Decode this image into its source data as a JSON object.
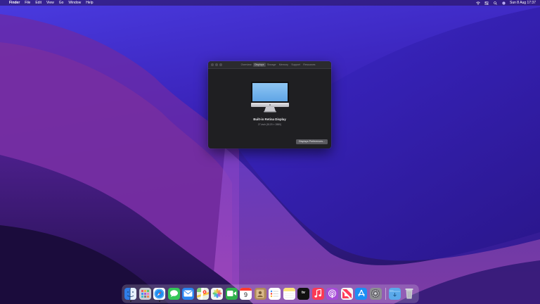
{
  "menubar": {
    "apple_glyph": "",
    "app_name": "Finder",
    "menus": [
      "File",
      "Edit",
      "View",
      "Go",
      "Window",
      "Help"
    ],
    "status_icons": [
      "wifi-icon",
      "control-center-icon",
      "search-icon",
      "siri-icon"
    ],
    "clock": "Sun 8 Aug 17:37"
  },
  "about_window": {
    "tabs": [
      "Overview",
      "Displays",
      "Storage",
      "Memory",
      "Support",
      "Resources"
    ],
    "active_tab": "Displays",
    "display_name": "Built-in Retina Display",
    "resolution": "27-inch (5120 × 2880)",
    "preferences_button": "Displays Preferences..."
  },
  "dock": {
    "apps": [
      {
        "name": "Finder",
        "icon": "finder-icon",
        "color": "#2f7de8",
        "running": true
      },
      {
        "name": "Launchpad",
        "icon": "launchpad-icon",
        "color": "#c9cdd6",
        "running": false
      },
      {
        "name": "Safari",
        "icon": "safari-icon",
        "color": "#1e8ef0",
        "running": true
      },
      {
        "name": "Messages",
        "icon": "messages-icon",
        "color": "#34c759",
        "running": false
      },
      {
        "name": "Mail",
        "icon": "mail-icon",
        "color": "#2a86f2",
        "running": false
      },
      {
        "name": "Maps",
        "icon": "maps-icon",
        "color": "#5ec26a",
        "running": false
      },
      {
        "name": "Photos",
        "icon": "photos-icon",
        "color": "#f4f4f4",
        "running": false
      },
      {
        "name": "FaceTime",
        "icon": "facetime-icon",
        "color": "#2fb24c",
        "running": false
      },
      {
        "name": "Calendar",
        "icon": "calendar-icon",
        "color": "#ffffff",
        "running": false
      },
      {
        "name": "Contacts",
        "icon": "contacts-icon",
        "color": "#b08a5a",
        "running": false
      },
      {
        "name": "Reminders",
        "icon": "reminders-icon",
        "color": "#ffffff",
        "running": false
      },
      {
        "name": "Notes",
        "icon": "notes-icon",
        "color": "#fbe47a",
        "running": false
      },
      {
        "name": "TV",
        "icon": "tv-icon",
        "color": "#111111",
        "running": false
      },
      {
        "name": "Music",
        "icon": "music-icon",
        "color": "#fa3a55",
        "running": false
      },
      {
        "name": "Podcasts",
        "icon": "podcasts-icon",
        "color": "#a64bd8",
        "running": false
      },
      {
        "name": "News",
        "icon": "news-icon",
        "color": "#f6f6f6",
        "running": false
      },
      {
        "name": "App Store",
        "icon": "app-store-icon",
        "color": "#1c8ff5",
        "running": false
      },
      {
        "name": "System Preferences",
        "icon": "system-preferences-icon",
        "color": "#8e8e93",
        "running": false
      },
      {
        "name": "Downloads",
        "icon": "downloads-folder-icon",
        "color": "#5aa9ea",
        "running": false
      },
      {
        "name": "Trash",
        "icon": "trash-icon",
        "color": "#c9ccd2",
        "running": false
      }
    ],
    "calendar_day": "9",
    "tv_label": "tv"
  },
  "colors": {
    "wallpaper_top": "#3a2bd6",
    "wallpaper_bottom": "#1c0f4a",
    "window_bg": "#1f1f22",
    "accent_blue": "#2a86f2"
  }
}
